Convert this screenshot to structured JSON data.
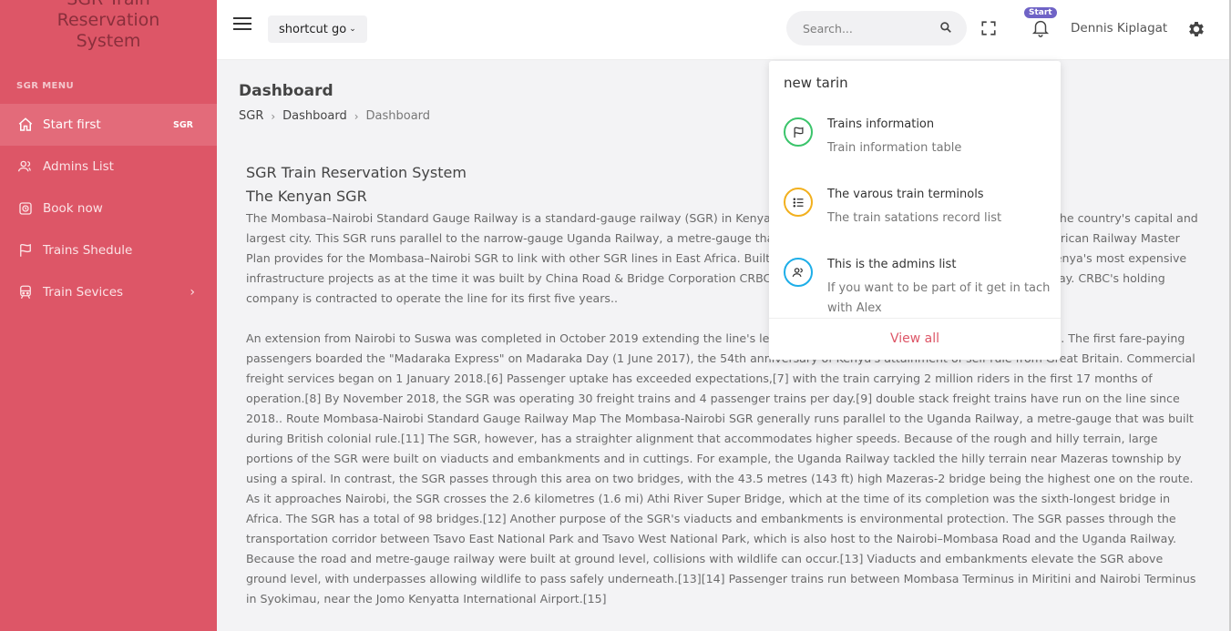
{
  "brand": {
    "line1": "SGR Train",
    "line2": "Reservation",
    "line3": "System"
  },
  "sidebar": {
    "menu_title": "SGR MENU",
    "items": [
      {
        "label": "Start first",
        "icon": "home-icon",
        "badge": "SGR"
      },
      {
        "label": "Admins List",
        "icon": "users-icon"
      },
      {
        "label": "Book now",
        "icon": "alarm-clock-icon"
      },
      {
        "label": "Trains Shedule",
        "icon": "flag-icon"
      },
      {
        "label": "Train Sevices",
        "icon": "train-icon",
        "has_submenu": true
      }
    ]
  },
  "topbar": {
    "shortcut_label": "shortcut go",
    "search_placeholder": "Search...",
    "notification_badge": "Start",
    "username": "Dennis Kiplagat"
  },
  "page": {
    "title": "Dashboard",
    "breadcrumb": [
      "SGR",
      "Dashboard",
      "Dashboard"
    ]
  },
  "article": {
    "title": "SGR Train Reservation System",
    "subtitle": "The Kenyan SGR",
    "para1": "The Mombasa–Nairobi Standard Gauge Railway is a standard-gauge railway (SGR) in Kenya that links the port city of Mombasa with Nairobi, the country's capital and largest city. This SGR runs parallel to the narrow-gauge Uganda Railway, a metre-gauge that was built during British colonial rule. The East African Railway Master Plan provides for the Mombasa–Nairobi SGR to link with other SGR lines in East Africa. Built at a cost of US$3.6 billion, the SGR was among Kenya's most expensive infrastructure projects as at the time it was built by China Road & Bridge Corporation CRBC, which hired 25,000 Kenyans to work on the railway. CRBC's holding company is contracted to operate the line for its first five years..",
    "para2": "An extension from Nairobi to Suswa was completed in October 2019 extending the line's length to approximately 578.8 kilometres (359.6 mi). The first fare-paying passengers boarded the \"Madaraka Express\" on Madaraka Day (1 June 2017), the 54th anniversary of Kenya's attainment of self-rule from Great Britain. Commercial freight services began on 1 January 2018.[6] Passenger uptake has exceeded expectations,[7] with the train carrying 2 million riders in the first 17 months of operation.[8] By November 2018, the SGR was operating 30 freight trains and 4 passenger trains per day.[9] double stack freight trains have run on the line since 2018.. Route Mombasa-Nairobi Standard Gauge Railway Map The Mombasa-Nairobi SGR generally runs parallel to the Uganda Railway, a metre-gauge that was built during British colonial rule.[11] The SGR, however, has a straighter alignment that accommodates higher speeds. Because of the rough and hilly terrain, large portions of the SGR were built on viaducts and embankments and in cuttings. For example, the Uganda Railway tackled the hilly terrain near Mazeras township by using a spiral. In contrast, the SGR passes through this area on two bridges, with the 43.5 metres (143 ft) high Mazeras-2 bridge being the highest one on the route. As it approaches Nairobi, the SGR crosses the 2.6 kilometres (1.6 mi) Athi River Super Bridge, which at the time of its completion was the sixth-longest bridge in Africa. The SGR has a total of 98 bridges.[12] Another purpose of the SGR's viaducts and embankments is environmental protection. The SGR passes through the transportation corridor between Tsavo East National Park and Tsavo West National Park, which is also host to the Nairobi–Mombasa Road and the Uganda Railway. Because the road and metre-gauge railway were built at ground level, collisions with wildlife can occur.[13] Viaducts and embankments elevate the SGR above ground level, with underpasses allowing wildlife to pass safely underneath.[13][14] Passenger trains run between Mombasa Terminus in Miritini and Nairobi Terminus in Syokimau, near the Jomo Kenyatta International Airport.[15]"
  },
  "notifications": {
    "title": "new tarin",
    "items": [
      {
        "title": "Trains information",
        "subtitle": "Train information table",
        "icon": "flag-icon",
        "color": "#3bc46b"
      },
      {
        "title": "The varous train terminols",
        "subtitle": "The train satations record list",
        "icon": "list-icon",
        "color": "#f2b01e"
      },
      {
        "title": "This is the admins list",
        "subtitle": "If you want to be part of it get in tach with Alex",
        "icon": "users-icon",
        "color": "#1eaee8"
      }
    ],
    "footer": "View all"
  },
  "colors": {
    "sidebar": "#dd5667",
    "accent": "#dd5667",
    "badge": "#6f63c6"
  }
}
